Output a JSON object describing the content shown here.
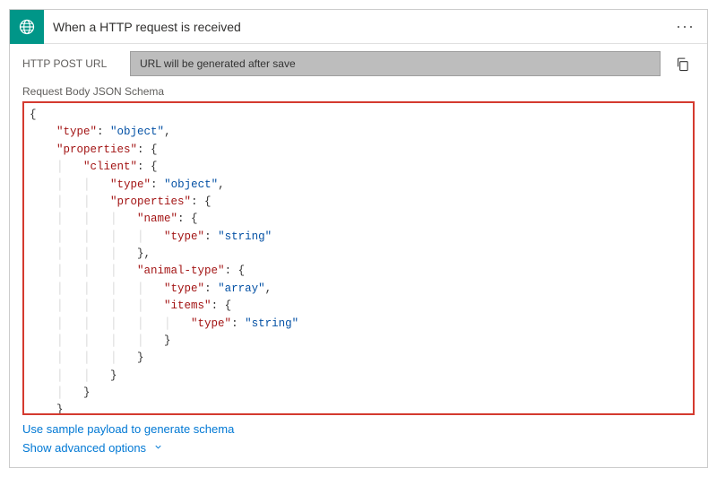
{
  "header": {
    "title": "When a HTTP request is received",
    "icon": "http-trigger-icon",
    "menu": "···"
  },
  "urlRow": {
    "label": "HTTP POST URL",
    "fieldText": "URL will be generated after save"
  },
  "schema": {
    "label": "Request Body JSON Schema",
    "json": {
      "type": "object",
      "properties": {
        "client": {
          "type": "object",
          "properties": {
            "name": {
              "type": "string"
            },
            "animal-type": {
              "type": "array",
              "items": {
                "type": "string"
              }
            }
          }
        }
      }
    }
  },
  "links": {
    "samplePayload": "Use sample payload to generate schema",
    "advancedOptions": "Show advanced options"
  }
}
